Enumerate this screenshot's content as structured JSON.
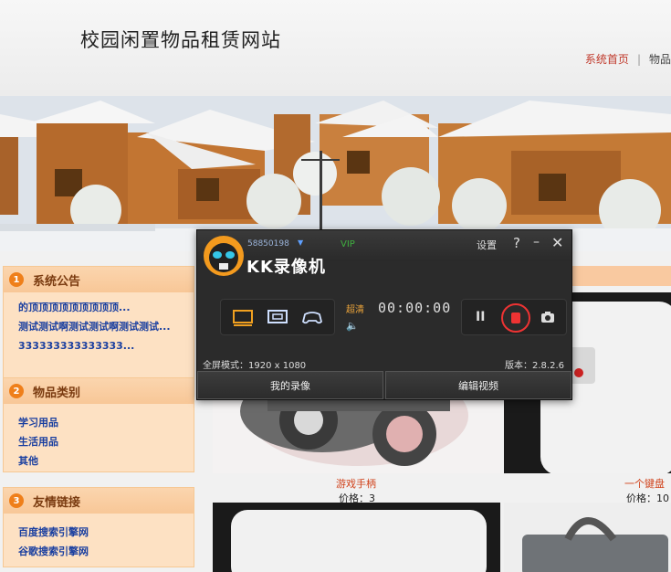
{
  "header": {
    "site_title": "校园闲置物品租赁网站",
    "nav_home": "系统首页",
    "nav_sep": "|",
    "nav_next": "物品"
  },
  "sidebar": {
    "announcements": {
      "num": "1",
      "title": "系统公告",
      "items": [
        "的顶顶顶顶顶顶顶顶顶...",
        "测试测试啊测试测试啊测试测试...",
        "333333333333333..."
      ]
    },
    "categories": {
      "num": "2",
      "title": "物品类别",
      "items": [
        "学习用品",
        "生活用品",
        "其他"
      ]
    },
    "links": {
      "num": "3",
      "title": "友情链接",
      "items": [
        "百度搜索引擎网",
        "谷歌搜索引擎网"
      ]
    }
  },
  "products": [
    {
      "name": "游戏手柄",
      "price": "价格：3"
    },
    {
      "name": "一个键盘",
      "price": "价格：10"
    }
  ],
  "recorder": {
    "uid": "58850198",
    "vip": "VIP",
    "settings": "设置",
    "help": "?",
    "minimize": "–",
    "close": "✕",
    "app_name": "KK录像机",
    "quality": "超清",
    "time": "00:00:00",
    "pause": "II",
    "fullscreen": "全屏模式：1920 x 1080",
    "version": "版本：2.8.2.6",
    "my_recordings": "我的录像",
    "edit_video": "编辑视频"
  },
  "colors": {
    "accent_orange": "#ef7f1a",
    "link_blue": "#1a3fa0",
    "price_red": "#d0421b",
    "recorder_bg": "#2b2b2b",
    "record_red": "#ee3333"
  }
}
